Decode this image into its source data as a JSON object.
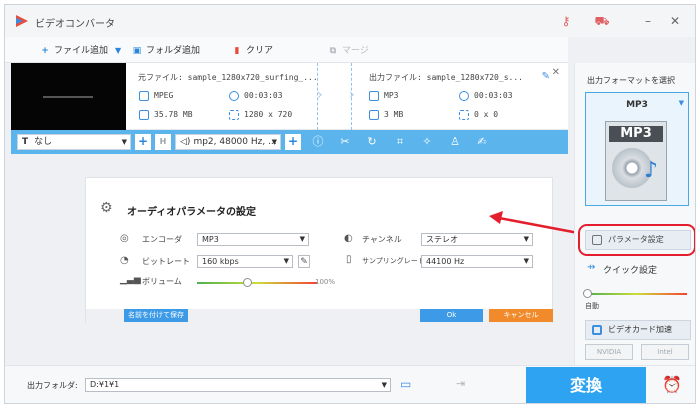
{
  "app": {
    "title": "ビデオコンバータ"
  },
  "toolbar": {
    "add_file": "ファイル追加",
    "add_folder": "フォルダ追加",
    "clear": "クリア",
    "merge": "マージ"
  },
  "file": {
    "source_name": "元ファイル: sample_1280x720_surfing_...",
    "source_format": "MPEG",
    "source_duration": "00:03:03",
    "source_size": "35.78 MB",
    "source_resolution": "1280 x 720",
    "output_name": "出力ファイル: sample_1280x720_s...",
    "output_format": "MP3",
    "output_duration": "00:03:03",
    "output_size": "3 MB",
    "output_resolution": "0 x 0"
  },
  "editbar": {
    "subtitle": "なし",
    "audio": "mp2, 48000 Hz, ..."
  },
  "dialog": {
    "title": "オーディオパラメータの設定",
    "encoder_label": "エンコーダ",
    "encoder_value": "MP3",
    "bitrate_label": "ビットレート",
    "bitrate_value": "160 kbps",
    "volume_label": "ボリューム",
    "volume_pct": "100%",
    "volume_level": 0.42,
    "channel_label": "チャンネル",
    "channel_value": "ステレオ",
    "samplerate_label": "サンプリングレート",
    "samplerate_value": "44100 Hz",
    "save_as": "名前を付けて保存",
    "ok": "Ok",
    "cancel": "キャンセル"
  },
  "sidebar": {
    "format_label": "出力フォーマットを選択",
    "format_name": "MP3",
    "format_badge": "MP3",
    "param_settings": "パラメータ設定",
    "quick_settings": "クイック設定",
    "quick_auto": "自動",
    "gpu_accel": "ビデオカード加速",
    "vendor_nvidia": "NVIDIA",
    "vendor_intel": "Intel"
  },
  "bottom": {
    "output_folder_label": "出力フォルダ:",
    "output_folder_value": "D:¥1¥1",
    "convert": "変換"
  },
  "colors": {
    "accent": "#2ea3f2",
    "toolbar_blue": "#5bb5ec",
    "cancel_orange": "#f08a2a",
    "annotation_red": "#e41f2d"
  }
}
